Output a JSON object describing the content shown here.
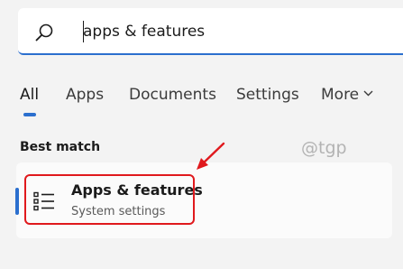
{
  "search": {
    "query": "apps & features",
    "accent_color": "#2b6fce"
  },
  "tabs": [
    {
      "label": "All",
      "active": true
    },
    {
      "label": "Apps",
      "active": false
    },
    {
      "label": "Documents",
      "active": false
    },
    {
      "label": "Settings",
      "active": false
    },
    {
      "label": "More",
      "active": false
    }
  ],
  "best_match": {
    "heading": "Best match",
    "result": {
      "title": "Apps & features",
      "subtitle": "System settings",
      "icon": "list-settings-icon"
    },
    "annotation_color": "#e0191d"
  },
  "watermark": "@tgp"
}
